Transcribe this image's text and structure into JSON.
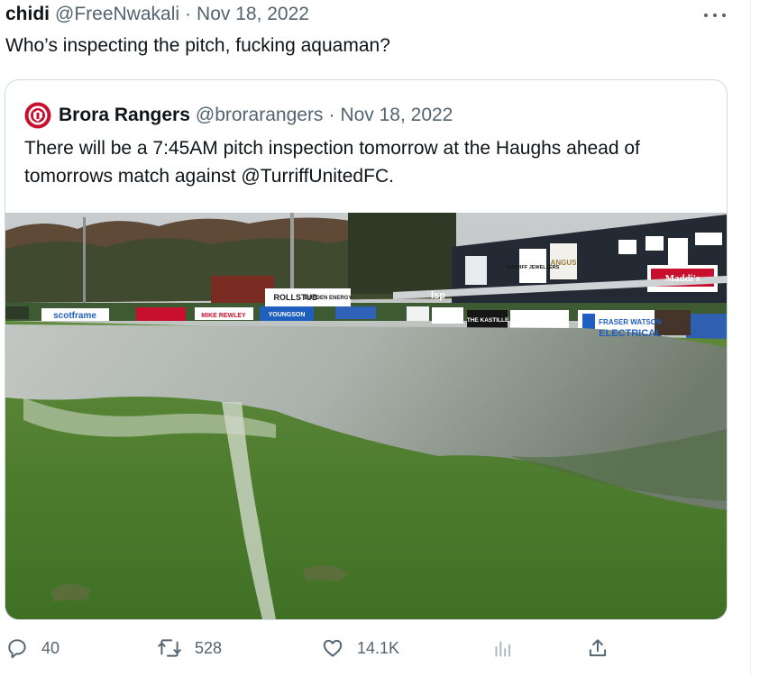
{
  "tweet": {
    "author_name": "chidi",
    "author_handle": "@FreeNwakali",
    "separator": "·",
    "date": "Nov 18, 2022",
    "text": "Who’s inspecting the pitch, fucking aquaman?",
    "more_icon": "more-horizontal-icon"
  },
  "quote": {
    "author_name": "Brora Rangers",
    "author_handle": "@brorarangers",
    "separator": "·",
    "date": "Nov 18, 2022",
    "text": "There will be a 7:45AM pitch inspection  tomorrow at the Haughs ahead of tomorrows match against @TurriffUnitedFC.",
    "media": {
      "board_labels": {
        "scotframe": "scotframe",
        "mike": "MIKE REWLEY",
        "youngson": "YOUNGSON",
        "fraser_line1": "FRASER WATSON",
        "fraser_line2": "ELECTRICAL",
        "maddis": "Maddi's",
        "kastille": "THE KASTILLE",
        "rollstud": "ROLLSTUD",
        "burden": "BURDEN ENERGY",
        "turriff": "TURRIFF JEWELLERS",
        "angus": "ANGUS",
        "lsp": "lsp"
      }
    }
  },
  "actions": {
    "replies": "40",
    "retweets": "528",
    "likes": "14.1K"
  },
  "colors": {
    "secondary_text": "#536471",
    "border": "#cfd9de",
    "club_red": "#c8102e"
  }
}
